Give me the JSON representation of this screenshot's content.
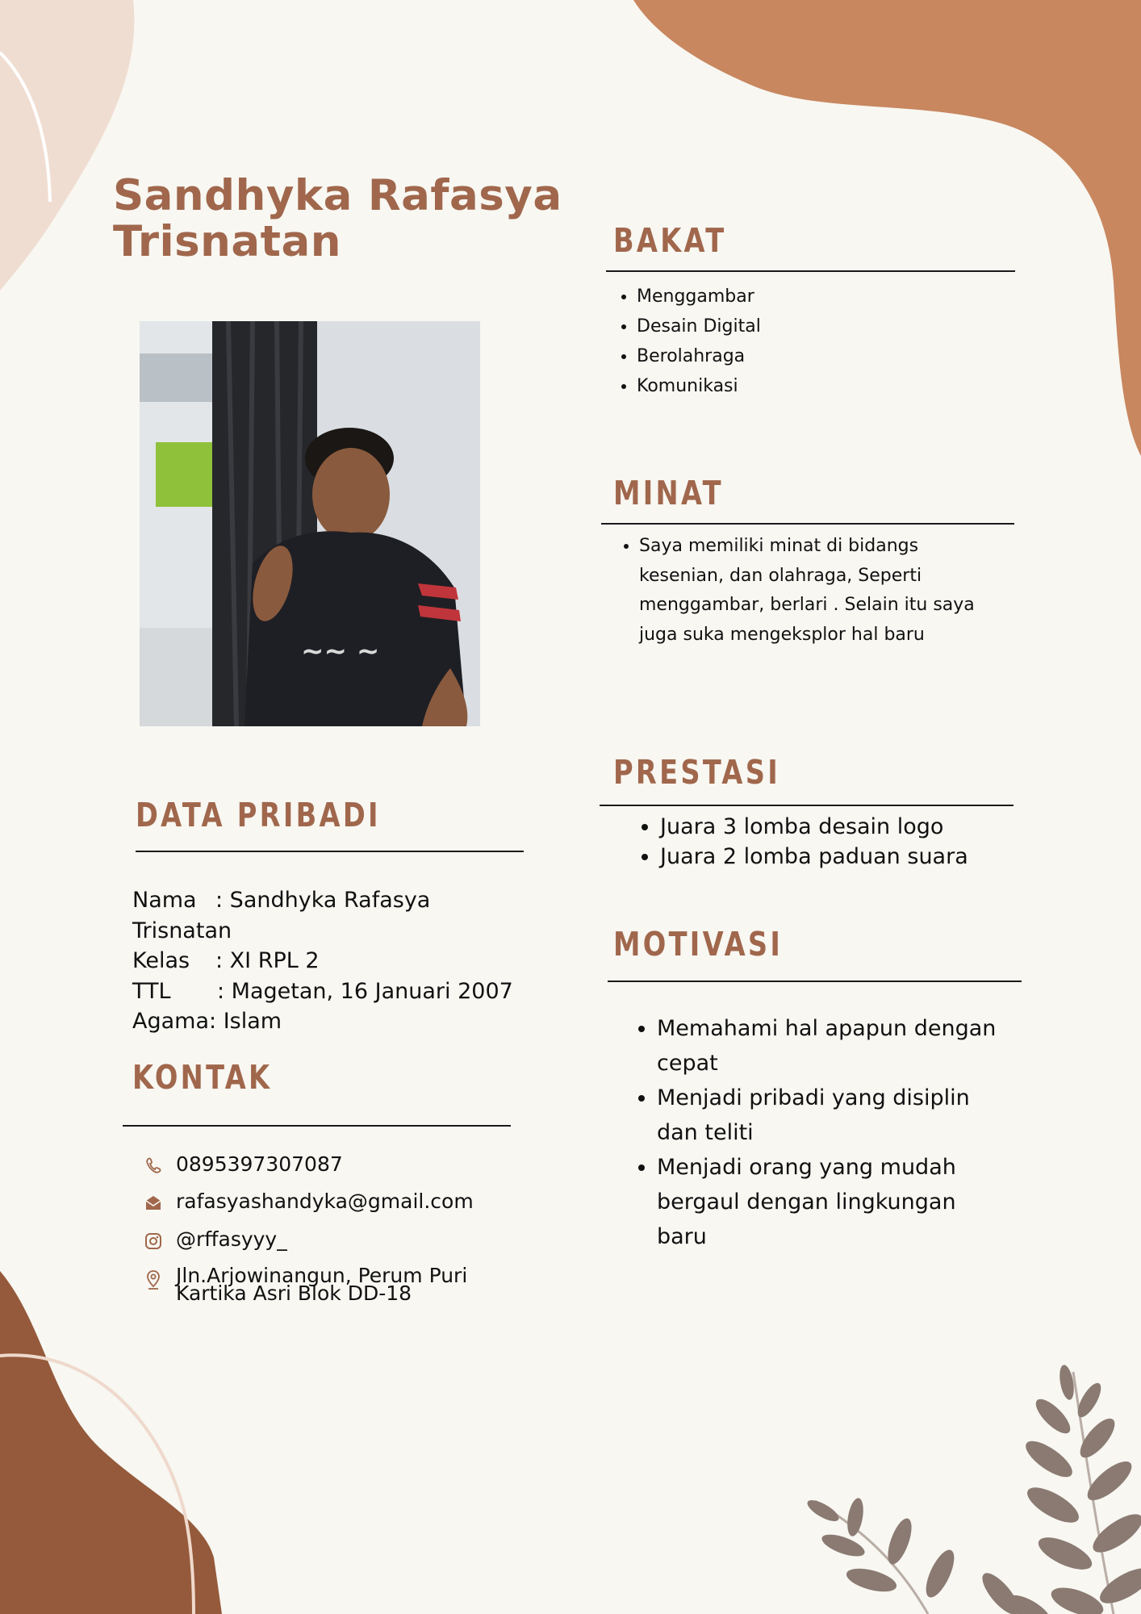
{
  "profile": {
    "name_line1": "Sandhyka Rafasya",
    "name_line2": "Trisnatan"
  },
  "colors": {
    "accent": "#a0674c",
    "blob_orange": "#c8875f",
    "blob_brown": "#955a3b",
    "blob_light": "#f0ddd1",
    "leaf": "#8a7a72",
    "background": "#f8f7f2"
  },
  "bakat": {
    "heading": "BAKAT",
    "items": [
      "Menggambar",
      "Desain Digital",
      "Berolahraga",
      "Komunikasi"
    ]
  },
  "minat": {
    "heading": "MINAT",
    "items": [
      "Saya memiliki minat di bidangs kesenian, dan olahraga, Seperti menggambar, berlari . Selain itu saya juga suka mengeksplor hal baru"
    ]
  },
  "prestasi": {
    "heading": "PRESTASI",
    "items": [
      "Juara 3 lomba desain logo",
      "Juara 2 lomba paduan suara"
    ]
  },
  "motivasi": {
    "heading": "MOTIVASI",
    "items": [
      "Memahami hal apapun dengan cepat",
      "Menjadi pribadi yang disiplin dan teliti",
      "Menjadi orang yang mudah bergaul dengan lingkungan baru"
    ]
  },
  "data_pribadi": {
    "heading": "DATA PRIBADI",
    "nama_label": "Nama",
    "nama_value": ": Sandhyka Rafasya",
    "nama_cont": "Trisnatan",
    "kelas_label": "Kelas",
    "kelas_value": ": XI RPL 2",
    "ttl_label": "TTL",
    "ttl_value": ": Magetan, 16 Januari 2007",
    "agama_label": "Agama",
    "agama_value": ": Islam"
  },
  "kontak": {
    "heading": "KONTAK",
    "phone": "0895397307087",
    "phone_icon": "phone-icon",
    "email": "rafasyashandyka@gmail.com",
    "email_icon": "envelope-icon",
    "instagram": "@rffasyyy_",
    "instagram_icon": "instagram-icon",
    "address_line1": "Jln.Arjowinangun, Perum Puri",
    "address_line2": "Kartika Asri Blok DD-18",
    "address_icon": "location-pin-icon"
  }
}
